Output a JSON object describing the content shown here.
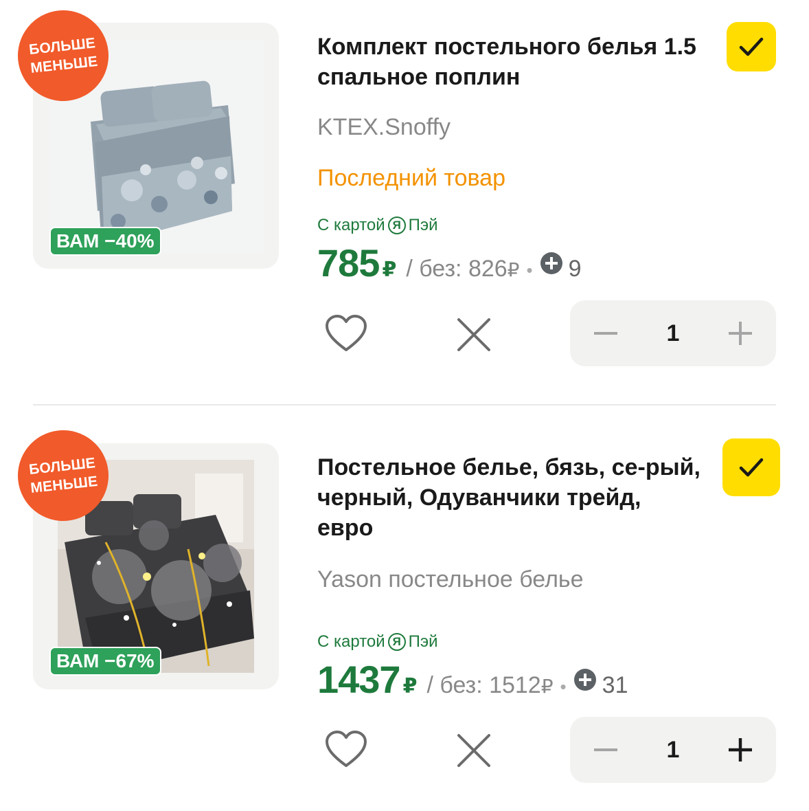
{
  "items": [
    {
      "promo_line1": "БОЛЬШЕ",
      "promo_line2": "МЕНЬШЕ",
      "discount": "ВАМ −40%",
      "title": "Комплект постельного белья 1.5 спальное поплин",
      "seller": "KTEX.Snoffy",
      "stock": "Последний товар",
      "card_label": "С картой",
      "card_brand": "Я",
      "card_name": "Пэй",
      "price": "785",
      "currency": "₽",
      "old_price": "/ без: 826",
      "points": "9",
      "quantity": "1",
      "selected": true
    },
    {
      "promo_line1": "БОЛЬШЕ",
      "promo_line2": "МЕНЬШЕ",
      "discount": "ВАМ −67%",
      "title": "Постельное белье, бязь, се-рый, черный, Одуванчики трейд, евро",
      "seller": "Yason постельное белье",
      "card_label": "С картой",
      "card_brand": "Я",
      "card_name": "Пэй",
      "price": "1437",
      "currency": "₽",
      "old_price": "/ без: 1512",
      "points": "31",
      "quantity": "1",
      "selected": true
    }
  ],
  "icons": {
    "favorite": "heart-icon",
    "remove": "close-icon",
    "decrease": "minus-icon",
    "increase": "plus-icon",
    "selected": "checkmark-icon",
    "plus_points": "plus-points-icon"
  },
  "colors": {
    "price_green": "#1e7a3c",
    "accent_yellow": "#ffdd00",
    "promo_red": "#f15a2a",
    "stock_orange": "#f39200",
    "discount_green": "#2ea15a"
  }
}
